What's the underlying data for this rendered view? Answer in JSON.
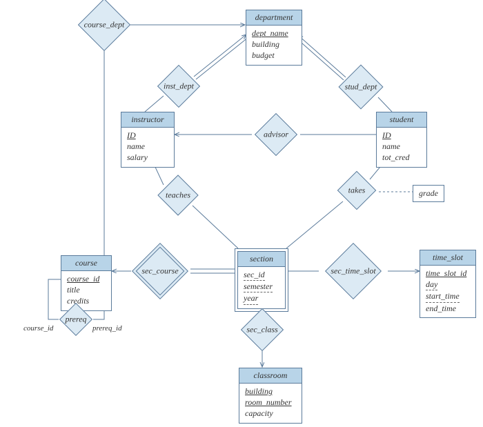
{
  "entities": {
    "department": {
      "title": "department",
      "attrs": [
        {
          "t": "dept_name",
          "pk": true
        },
        {
          "t": "building"
        },
        {
          "t": "budget"
        }
      ]
    },
    "instructor": {
      "title": "instructor",
      "attrs": [
        {
          "t": "ID",
          "pk": true
        },
        {
          "t": "name"
        },
        {
          "t": "salary"
        }
      ]
    },
    "student": {
      "title": "student",
      "attrs": [
        {
          "t": "ID",
          "pk": true
        },
        {
          "t": "name"
        },
        {
          "t": "tot_cred"
        }
      ]
    },
    "course": {
      "title": "course",
      "attrs": [
        {
          "t": "course_id",
          "pk": true
        },
        {
          "t": "title"
        },
        {
          "t": "credits"
        }
      ]
    },
    "section": {
      "title": "section",
      "attrs": [
        {
          "t": "sec_id",
          "dash": true
        },
        {
          "t": "semester",
          "dash": true
        },
        {
          "t": "year",
          "dash": true
        }
      ]
    },
    "time_slot": {
      "title": "time_slot",
      "attrs": [
        {
          "t": "time_slot_id",
          "pk": true
        },
        {
          "t": "day",
          "dash": true
        },
        {
          "t": "start_time",
          "dash": true
        },
        {
          "t": "end_time"
        }
      ]
    },
    "classroom": {
      "title": "classroom",
      "attrs": [
        {
          "t": "building",
          "pk": true
        },
        {
          "t": "room_number",
          "pk": true
        },
        {
          "t": "capacity"
        }
      ]
    }
  },
  "relationships": {
    "course_dept": "course_dept",
    "inst_dept": "inst_dept",
    "stud_dept": "stud_dept",
    "advisor": "advisor",
    "teaches": "teaches",
    "takes": "takes",
    "sec_course": "sec_course",
    "sec_time_slot": "sec_time_slot",
    "sec_class": "sec_class",
    "prereq": "prereq"
  },
  "attrbox": {
    "grade": "grade"
  },
  "roles": {
    "course_id": "course_id",
    "prereq_id": "prereq_id"
  }
}
